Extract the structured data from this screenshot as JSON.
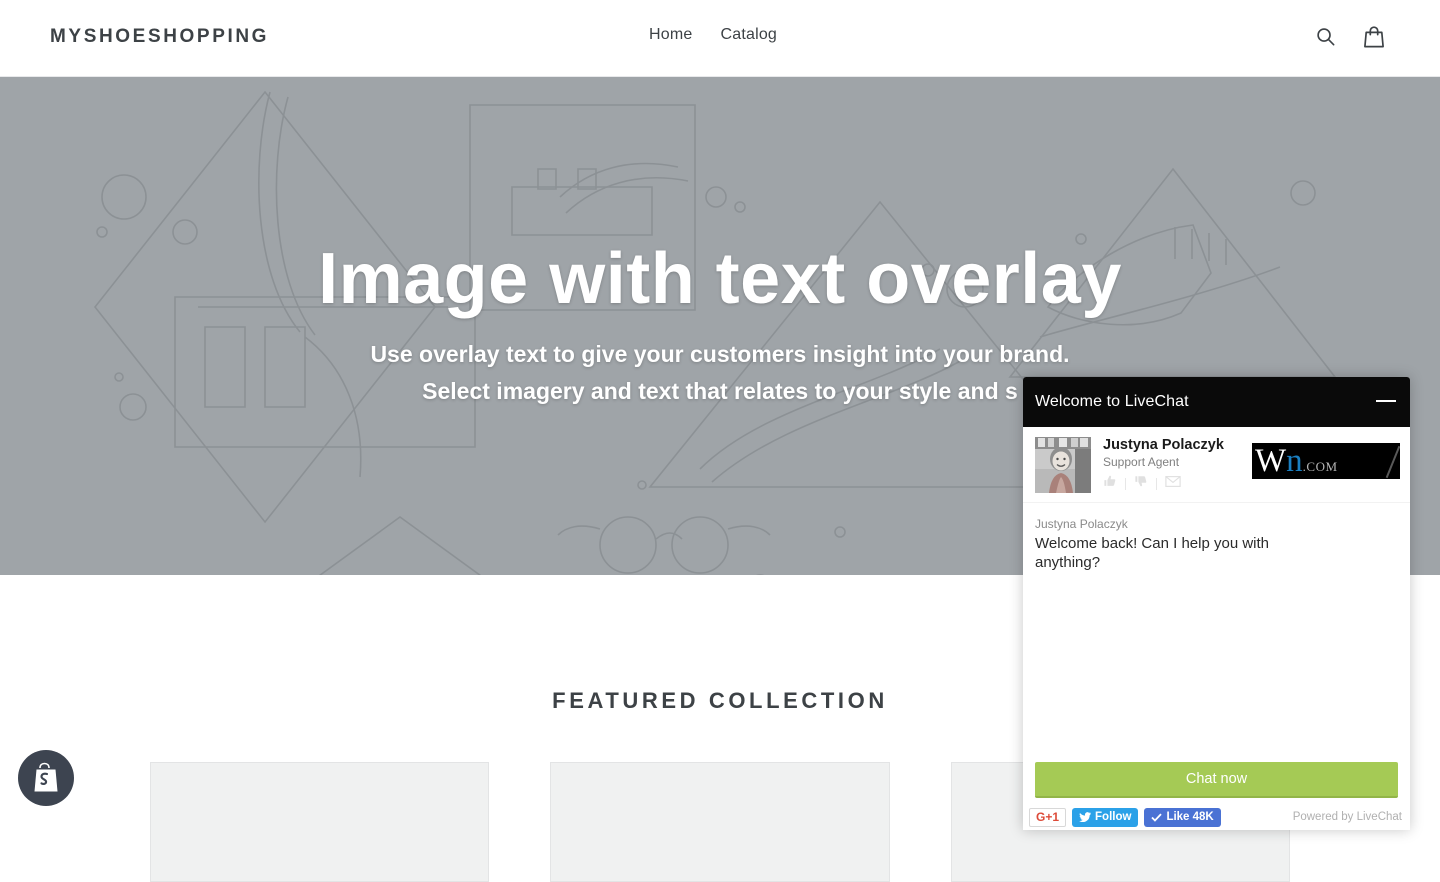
{
  "header": {
    "brand": "MYSHOESHOPPING",
    "nav": [
      {
        "label": "Home"
      },
      {
        "label": "Catalog"
      }
    ],
    "icons": {
      "search": "search-icon",
      "cart": "cart-icon"
    }
  },
  "hero": {
    "heading": "Image with text overlay",
    "subheading_line1": "Use overlay text to give your customers insight into your brand.",
    "subheading_line2": "Select imagery and text that relates to your style and s",
    "background_color": "#9fa4a8"
  },
  "featured": {
    "title": "FEATURED COLLECTION",
    "cards": [
      {
        "name": "product-card-1"
      },
      {
        "name": "product-card-2"
      },
      {
        "name": "product-card-3"
      }
    ]
  },
  "shopify_badge": {
    "name": "shopify-logo",
    "color": "#3d4450"
  },
  "chat": {
    "title": "Welcome to LiveChat",
    "minimize_label": "",
    "agent": {
      "name": "Justyna Polaczyk",
      "role": "Support Agent",
      "actions": [
        "thumbs-up-icon",
        "thumbs-down-icon",
        "envelope-icon"
      ]
    },
    "sponsor_logo": {
      "w": "W",
      "n": "n",
      "com": ".COM"
    },
    "message": {
      "author": "Justyna Polaczyk",
      "text": "Welcome back! Can I help you with anything?"
    },
    "cta_label": "Chat now",
    "social": {
      "gplus": "G+1",
      "twitter": "Follow",
      "facebook": "Like 48K"
    },
    "powered_by": "Powered by LiveChat",
    "accent_color": "#a5ca55"
  }
}
